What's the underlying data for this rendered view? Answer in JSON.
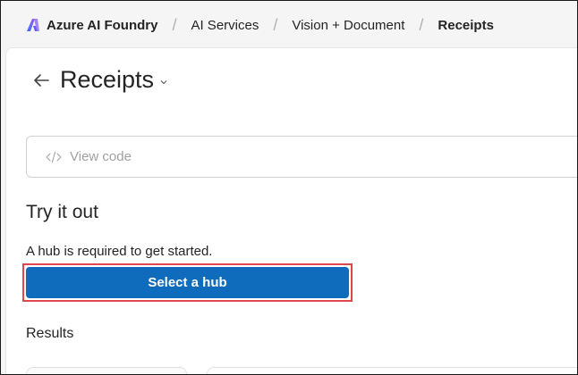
{
  "breadcrumb": {
    "brand": "Azure AI Foundry",
    "items": [
      "AI Services",
      "Vision + Document"
    ],
    "current": "Receipts"
  },
  "page": {
    "title": "Receipts"
  },
  "view_code": {
    "label": "View code"
  },
  "try_it_out": {
    "heading": "Try it out",
    "hub_message": "A hub is required to get started.",
    "select_hub_label": "Select a hub"
  },
  "results": {
    "heading": "Results"
  },
  "colors": {
    "primary_button": "#0f6cbd",
    "highlight_border": "#e0474c"
  }
}
